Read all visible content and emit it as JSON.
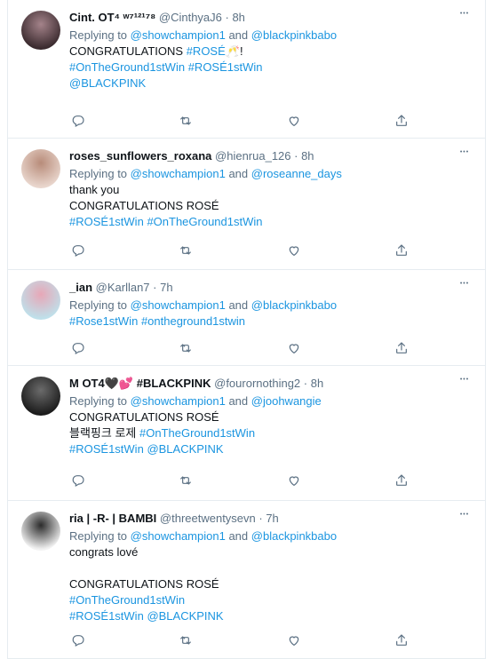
{
  "tweets": [
    {
      "name": "Cint. OT⁴ ʷ⁷¹²¹⁷⁸",
      "handle": "@CinthyaJ6",
      "time": "8h",
      "replying_label": "Replying to",
      "mention1": "@showchampion1",
      "and_label": "and",
      "mention2": "@blackpinkbabo",
      "lines": [
        [
          {
            "t": "CONGRATULATIONS ",
            "k": "text"
          },
          {
            "t": "#ROSÉ",
            "k": "link"
          },
          {
            "t": "🥂",
            "k": "text"
          },
          {
            "t": "!",
            "k": "text"
          }
        ],
        [
          {
            "t": "#OnTheGround1stWin",
            "k": "link"
          },
          {
            "t": " ",
            "k": "text"
          },
          {
            "t": "#ROSÉ1stWin",
            "k": "link"
          }
        ],
        [
          {
            "t": "@BLACKPINK",
            "k": "link"
          }
        ]
      ],
      "avatar_colors": [
        "#3a2a2e",
        "#a4838a"
      ]
    },
    {
      "name": "roses_sunflowers_roxana",
      "handle": "@hienrua_126",
      "time": "8h",
      "replying_label": "Replying to",
      "mention1": "@showchampion1",
      "and_label": "and",
      "mention2": "@roseanne_days",
      "lines": [
        [
          {
            "t": "thank you",
            "k": "text"
          }
        ],
        [
          {
            "t": "CONGRATULATIONS ROSÉ",
            "k": "text"
          }
        ],
        [
          {
            "t": "#ROSÉ1stWin",
            "k": "link"
          },
          {
            "t": " ",
            "k": "text"
          },
          {
            "t": "#OnTheGround1stWin",
            "k": "link"
          }
        ]
      ],
      "avatar_colors": [
        "#e9d6cd",
        "#b88c7a"
      ]
    },
    {
      "name": "_ian",
      "handle": "@Karllan7",
      "time": "7h",
      "replying_label": "Replying to",
      "mention1": "@showchampion1",
      "and_label": "and",
      "mention2": "@blackpinkbabo",
      "lines": [
        [
          {
            "t": "#Rose1stWin",
            "k": "link"
          },
          {
            "t": " ",
            "k": "text"
          },
          {
            "t": "#ontheground1stwin",
            "k": "link"
          }
        ]
      ],
      "avatar_colors": [
        "#bfe0ea",
        "#e7a7b7"
      ]
    },
    {
      "name": "M OT4🖤💕 #BLACKPINK",
      "handle": "@fourornothing2",
      "time": "8h",
      "replying_label": "Replying to",
      "mention1": "@showchampion1",
      "and_label": "and",
      "mention2": "@joohwangie",
      "lines": [
        [
          {
            "t": "CONGRATULATIONS ROSÉ",
            "k": "text"
          }
        ],
        [
          {
            "t": "블랙핑크 로제 ",
            "k": "text"
          },
          {
            "t": "#OnTheGround1stWin",
            "k": "link"
          }
        ],
        [
          {
            "t": " ",
            "k": "text"
          },
          {
            "t": "#ROSÉ1stWin",
            "k": "link"
          },
          {
            "t": " ",
            "k": "text"
          },
          {
            "t": "@BLACKPINK",
            "k": "link"
          }
        ]
      ],
      "avatar_colors": [
        "#1b1b1b",
        "#6b6b6b"
      ]
    },
    {
      "name": "ria | -R- | BAMBI",
      "handle": "@threetwentysevn",
      "time": "7h",
      "replying_label": "Replying to",
      "mention1": "@showchampion1",
      "and_label": "and",
      "mention2": "@blackpinkbabo",
      "lines": [
        [
          {
            "t": "congrats lové",
            "k": "text"
          }
        ],
        [],
        [
          {
            "t": "CONGRATULATIONS ROSÉ",
            "k": "text"
          }
        ],
        [
          {
            "t": "#OnTheGround1stWin",
            "k": "link"
          }
        ],
        [
          {
            "t": "#ROSÉ1stWin",
            "k": "link"
          },
          {
            "t": " ",
            "k": "text"
          },
          {
            "t": "@BLACKPINK",
            "k": "link"
          }
        ]
      ],
      "avatar_colors": [
        "#f2f2f2",
        "#2b2b2b"
      ]
    }
  ],
  "icons": {
    "reply": "reply-icon",
    "retweet": "retweet-icon",
    "like": "heart-icon",
    "share": "share-icon",
    "more": "more-icon"
  },
  "colors": {
    "link": "#1b95e0",
    "muted": "#5b7083",
    "border": "#e6ecf0"
  }
}
